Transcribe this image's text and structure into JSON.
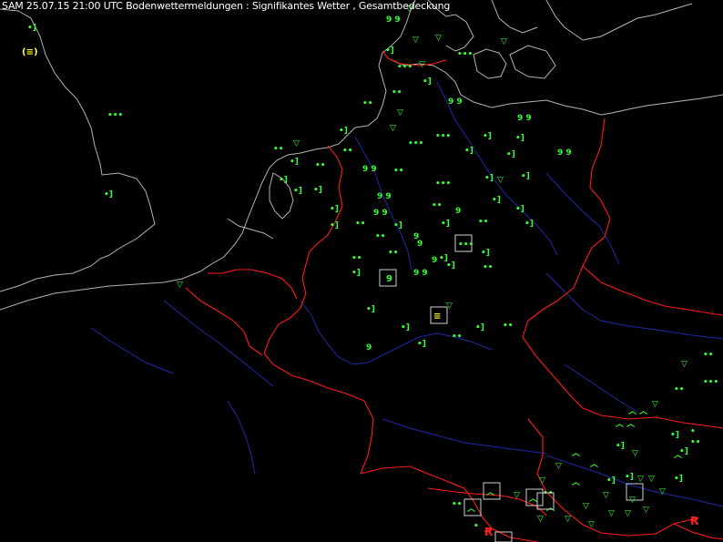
{
  "header": {
    "title": "SAM 25.07.15 21:00 UTC  Bodenwettermeldungen :  Signifikantes Wetter , Gesamtbedeckung"
  },
  "colors": {
    "background": "#000000",
    "coastline": "#b4b4b4",
    "country_border": "#ff1a1a",
    "river": "#1c2aa8",
    "weather_symbol": "#33ff33",
    "special_symbol": "#ffff00",
    "red_symbol": "#ff2020"
  },
  "legend_icons": {
    "drizzle": "drizzle-icon",
    "rain": "rain-icon",
    "rain_shower": "rain-shower-icon",
    "shower": "shower-icon",
    "thunderstorm": "thunderstorm-icon",
    "fog": "fog-icon",
    "heavy_thunderstorm": "thunderstorm-red-icon"
  }
}
